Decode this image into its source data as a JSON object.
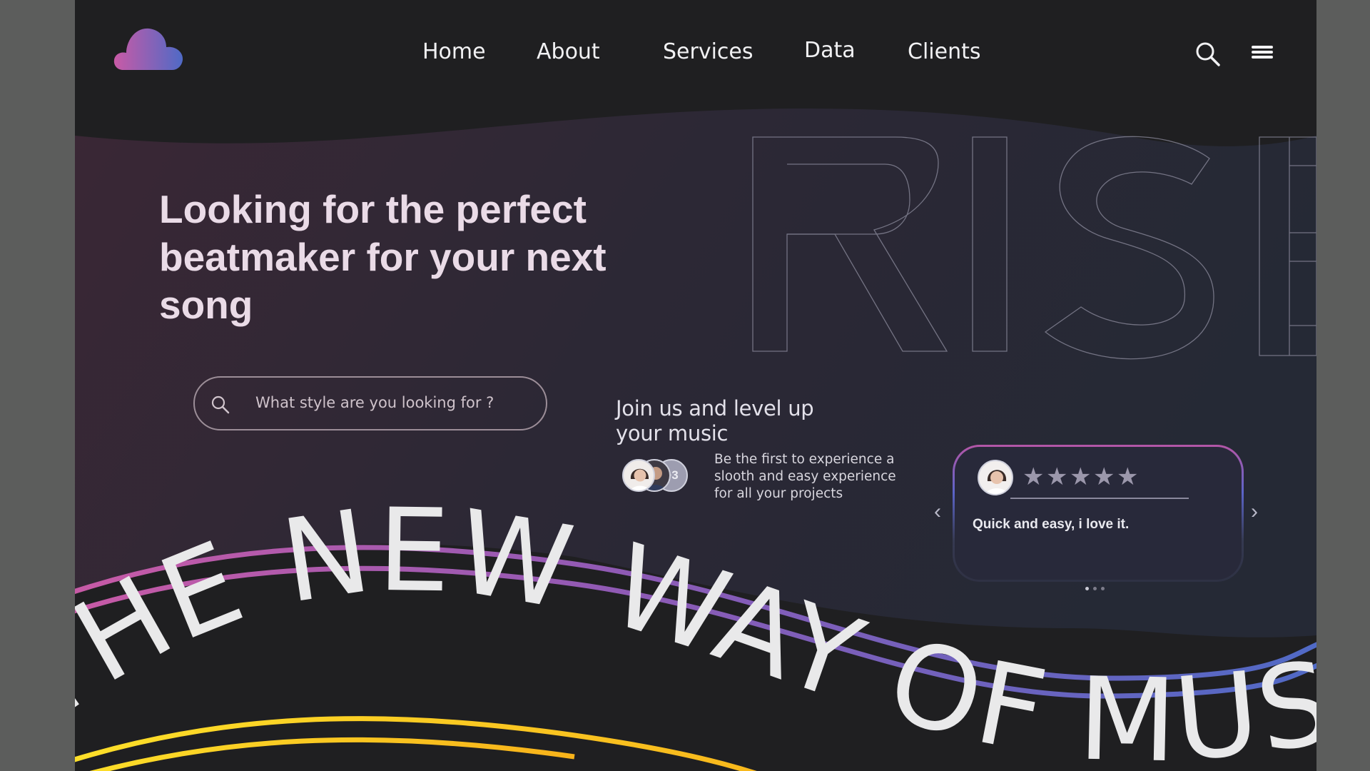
{
  "nav": {
    "links": [
      "Home",
      "About",
      "Services",
      "Data",
      "Clients"
    ]
  },
  "hero": {
    "title": "Looking for the perfect beatmaker for your next song",
    "background_word": "RISE"
  },
  "search": {
    "placeholder": "What style are you looking for ?"
  },
  "join": {
    "title": "Join us and level up your music",
    "extra_members": "+3",
    "text": "Be the first to experience a slooth and easy experience for all your projects"
  },
  "review": {
    "rating": 5,
    "rating_max": 5,
    "text": "Quick and easy, i love it.",
    "page_count": 3,
    "active_page": 1
  },
  "banner": {
    "text": "THE NEW WAY OF MUSI"
  },
  "colors": {
    "background": "#1f1f21",
    "hero_gradient_start": "#3a2735",
    "hero_gradient_end": "#252935",
    "pink": "#c35aa8",
    "blue": "#4f6ac6",
    "yellow": "#f7c52a",
    "title_text": "#eadbe7"
  },
  "icons": {
    "logo": "cloud-logo-icon",
    "search": "search-icon",
    "menu": "hamburger-menu-icon"
  }
}
